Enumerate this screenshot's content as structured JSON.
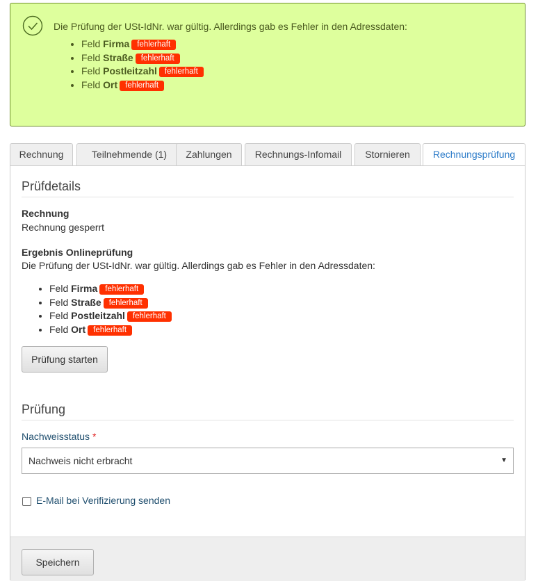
{
  "alert": {
    "message": "Die Prüfung der USt-IdNr. war gültig. Allerdings gab es Fehler in den Adressdaten:",
    "fields": [
      {
        "prefix": "Feld",
        "name": "Firma",
        "status": "fehlerhaft"
      },
      {
        "prefix": "Feld",
        "name": "Straße",
        "status": "fehlerhaft"
      },
      {
        "prefix": "Feld",
        "name": "Postleitzahl",
        "status": "fehlerhaft"
      },
      {
        "prefix": "Feld",
        "name": "Ort",
        "status": "fehlerhaft"
      }
    ],
    "icon": "check-circle-icon"
  },
  "tabs": [
    "Rechnung",
    "Teilnehmende (1)",
    "Zahlungen",
    "Rechnungs-Infomail",
    "Stornieren",
    "Rechnungsprüfung"
  ],
  "active_tab": "Rechnungsprüfung",
  "pruefdetails": {
    "title": "Prüfdetails",
    "rechnung_label": "Rechnung",
    "rechnung_value": "Rechnung gesperrt",
    "ergebnis_label": "Ergebnis Onlineprüfung",
    "ergebnis_text": "Die Prüfung der USt-IdNr. war gültig. Allerdings gab es Fehler in den Adressdaten:",
    "fields": [
      {
        "prefix": "Feld",
        "name": "Firma",
        "status": "fehlerhaft"
      },
      {
        "prefix": "Feld",
        "name": "Straße",
        "status": "fehlerhaft"
      },
      {
        "prefix": "Feld",
        "name": "Postleitzahl",
        "status": "fehlerhaft"
      },
      {
        "prefix": "Feld",
        "name": "Ort",
        "status": "fehlerhaft"
      }
    ],
    "start_button": "Prüfung starten"
  },
  "pruefung": {
    "title": "Prüfung",
    "status_label": "Nachweisstatus",
    "required_mark": "*",
    "status_value": "Nachweis nicht erbracht",
    "email_label": "E-Mail bei Verifizierung senden",
    "email_checked": false
  },
  "footer": {
    "save_button": "Speichern"
  },
  "colors": {
    "alert_bg": "#deff9d",
    "badge": "#ff3000",
    "active_tab_text": "#2a7ac8"
  }
}
